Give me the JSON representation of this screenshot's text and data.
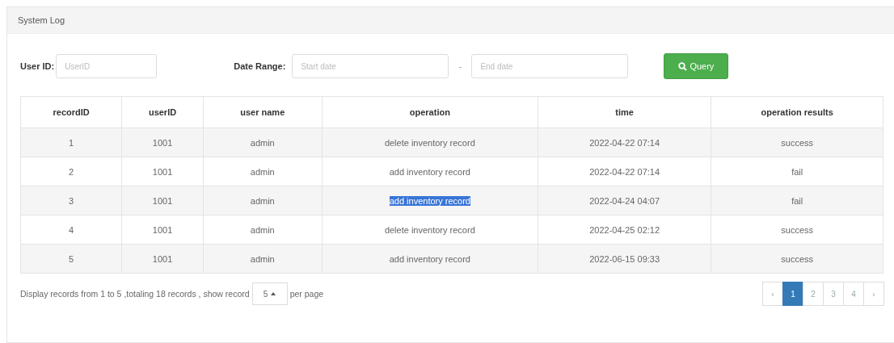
{
  "panel": {
    "title": "System Log"
  },
  "filters": {
    "user_id": {
      "label": "User ID:",
      "placeholder": "UserID"
    },
    "date_range": {
      "label": "Date Range:",
      "start_placeholder": "Start date",
      "separator": "-",
      "end_placeholder": "End date"
    },
    "query_button": "Query"
  },
  "table": {
    "columns": [
      "recordID",
      "userID",
      "user name",
      "operation",
      "time",
      "operation results"
    ],
    "rows": [
      {
        "cells": [
          "1",
          "1001",
          "admin",
          "delete inventory record",
          "2022-04-22 07:14",
          "success"
        ],
        "text_selected": false
      },
      {
        "cells": [
          "2",
          "1001",
          "admin",
          "add inventory record",
          "2022-04-22 07:14",
          "fail"
        ],
        "text_selected": false
      },
      {
        "cells": [
          "3",
          "1001",
          "admin",
          "add inventory record",
          "2022-04-24 04:07",
          "fail"
        ],
        "text_selected": true
      },
      {
        "cells": [
          "4",
          "1001",
          "admin",
          "delete inventory record",
          "2022-04-25 02:12",
          "success"
        ],
        "text_selected": false
      },
      {
        "cells": [
          "5",
          "1001",
          "admin",
          "add inventory record",
          "2022-06-15 09:33",
          "success"
        ],
        "text_selected": false
      }
    ]
  },
  "footer": {
    "summary": "Display records from 1 to 5 ,totaling 18 records , show record",
    "page_size": "5",
    "per_page": "per page"
  },
  "pagination": [
    {
      "label": "‹",
      "selected": false
    },
    {
      "label": "1",
      "selected": true
    },
    {
      "label": "2",
      "selected": false
    },
    {
      "label": "3",
      "selected": false
    },
    {
      "label": "4",
      "selected": false
    },
    {
      "label": "›",
      "selected": false
    }
  ]
}
